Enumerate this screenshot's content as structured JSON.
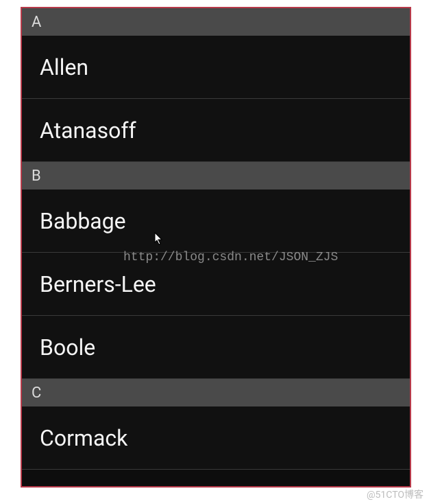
{
  "sections": [
    {
      "letter": "A",
      "items": [
        "Allen",
        "Atanasoff"
      ]
    },
    {
      "letter": "B",
      "items": [
        "Babbage",
        "Berners-Lee",
        "Boole"
      ]
    },
    {
      "letter": "C",
      "items": [
        "Cormack"
      ]
    }
  ],
  "watermark": {
    "url": "http://blog.csdn.net/JSON_ZJS",
    "footer": "@51CTO博客"
  }
}
